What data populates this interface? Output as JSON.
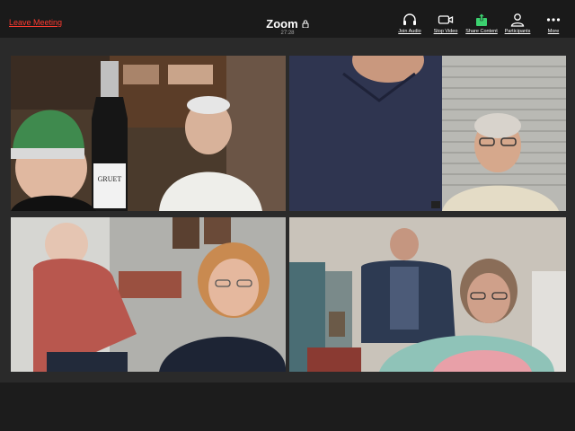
{
  "header": {
    "leave_label": "Leave Meeting",
    "title": "Zoom",
    "timer": "27:28"
  },
  "toolbar": {
    "join_audio": "Join Audio",
    "stop_video": "Stop Video",
    "share_content": "Share Content",
    "participants": "Participants",
    "more": "More"
  },
  "colors": {
    "leave": "#ff3b30",
    "share_accent": "#3bd16f"
  },
  "bottle_label": "GRUET"
}
